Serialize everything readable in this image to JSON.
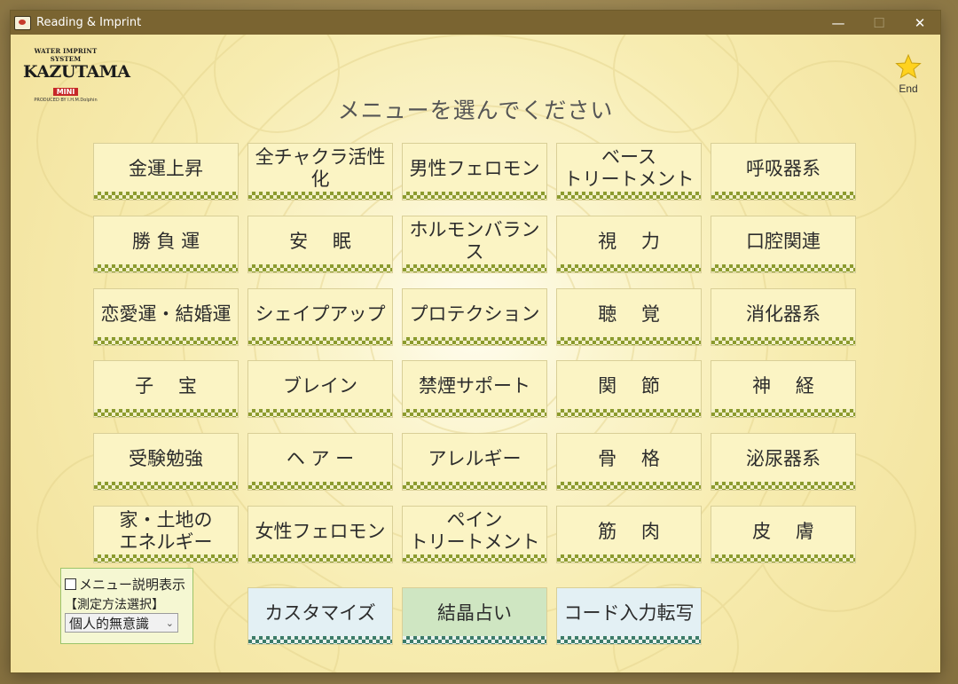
{
  "window": {
    "title": "Reading & Imprint",
    "minimize": "—",
    "maximize": "☐",
    "close": "✕"
  },
  "logo": {
    "line1": "WATER IMPRINT SYSTEM",
    "line2": "KAZUTAMA",
    "line3": "MINI",
    "line4": "PRODUCED BY I.H.M.Dolphin"
  },
  "end_button": {
    "label": "End"
  },
  "heading": "メニューを選んでください",
  "menu": [
    [
      "金運上昇",
      "全チャクラ活性化",
      "男性フェロモン",
      "ベース\nトリートメント",
      "呼吸器系"
    ],
    [
      "勝 負 運",
      "安　 眠",
      "ホルモンバランス",
      "視　 力",
      "口腔関連"
    ],
    [
      "恋愛運・結婚運",
      "シェイプアップ",
      "プロテクション",
      "聴　 覚",
      "消化器系"
    ],
    [
      "子　 宝",
      "ブレイン",
      "禁煙サポート",
      "関　 節",
      "神　 経"
    ],
    [
      "受験勉強",
      "ヘ ア ー",
      "アレルギー",
      "骨　 格",
      "泌尿器系"
    ],
    [
      "家・土地の\nエネルギー",
      "女性フェロモン",
      "ペイン\nトリートメント",
      "筋　 肉",
      "皮　 膚"
    ]
  ],
  "bottom_buttons": [
    "カスタマイズ",
    "結晶占い",
    "コード入力転写"
  ],
  "options": {
    "show_description_label": "メニュー説明表示",
    "show_description_checked": false,
    "method_heading": "【測定方法選択】",
    "method_selected": "個人的無意識"
  },
  "colors": {
    "titlebar": "#7a6431",
    "button_face": "#fbf4c4",
    "checker_olive": "#8c9b2e",
    "checker_teal": "#3c7c6a",
    "customize_face": "#e3f0f4",
    "crystal_face": "#cfe6c2",
    "star": "#ffd21f"
  }
}
